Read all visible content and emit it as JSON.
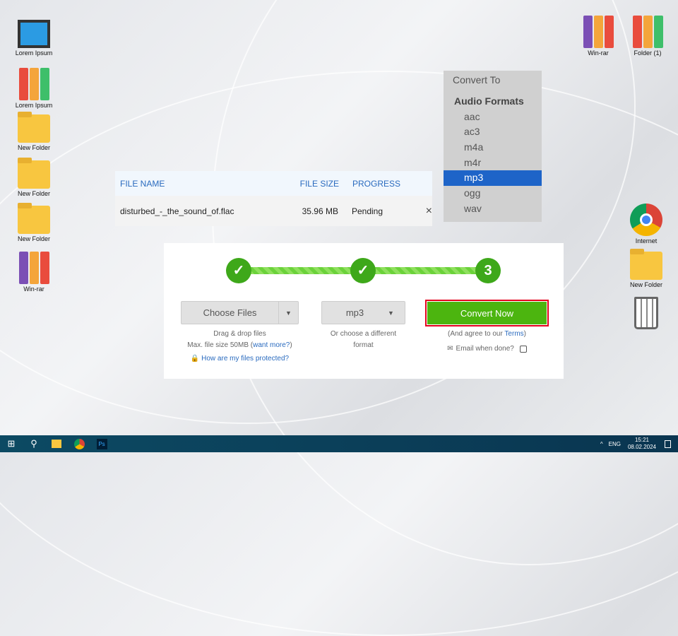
{
  "desktop": {
    "left_icons": [
      "Lorem Ipsum",
      "Lorem Ipsum",
      "New Folder",
      "New Folder",
      "New Folder",
      "Win-rar"
    ],
    "top_right_icons": [
      "Win-rar",
      "Folder (1)"
    ],
    "right_icons": [
      "Internet",
      "New Folder"
    ]
  },
  "table": {
    "headers": [
      "FILE NAME",
      "FILE SIZE",
      "PROGRESS"
    ],
    "row": {
      "name": "disturbed_-_the_sound_of.flac",
      "size": "35.96 MB",
      "progress": "Pending",
      "remove": "×"
    }
  },
  "menu": {
    "title": "Convert To",
    "group": "Audio Formats",
    "options": [
      "aac",
      "ac3",
      "m4a",
      "m4r",
      "mp3",
      "ogg",
      "wav"
    ],
    "selected": "mp3"
  },
  "steps": {
    "step1": "✓",
    "step2": "✓",
    "step3": "3"
  },
  "choose": {
    "label": "Choose Files",
    "hint1": "Drag & drop files",
    "hint2": "Max. file size 50MB (",
    "link": "want more?",
    "hint2_end": ")",
    "protect": "How are my files protected?"
  },
  "format": {
    "value": "mp3",
    "hint": "Or choose a different format"
  },
  "convert": {
    "label": "Convert Now",
    "agree": "(And agree to our ",
    "terms": "Terms",
    "agree_end": ")",
    "email": "Email when done?"
  },
  "taskbar": {
    "lang": "ENG",
    "time": "15:21",
    "date": "08.02.2024"
  },
  "colors": {
    "accent": "#4cb50f",
    "highlight": "#1e64c8",
    "focus": "#e3001b"
  }
}
